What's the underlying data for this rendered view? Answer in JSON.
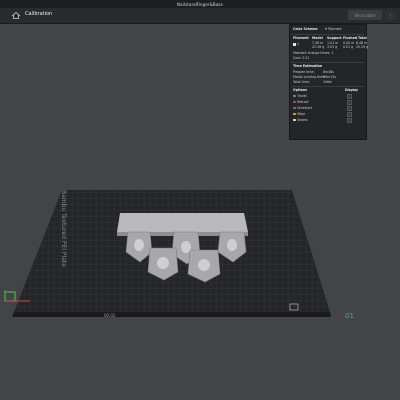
{
  "window": {
    "title": "NailstandFinger&Base"
  },
  "toolbar": {
    "tab_label": "Calibration",
    "slice_label": "Slice plate",
    "more_label": "⋮"
  },
  "panel": {
    "color_scheme_label": "Color Scheme",
    "color_scheme_value": "Filament",
    "headers": [
      "Filament",
      "Model",
      "Support",
      "Flushed",
      "Total"
    ],
    "filament_row": {
      "index": "1",
      "model": [
        "7.46 m",
        "22.26 g"
      ],
      "support": [
        "1.01 m",
        "3.03 g"
      ],
      "flushed": [
        "0.00 m",
        "0.01 g"
      ],
      "total": [
        "8.48 m",
        "25.29 g"
      ]
    },
    "change_times_label": "Filament change times:",
    "change_times_value": "1",
    "cost_label": "Cost:",
    "cost_value": "0.51",
    "time_title": "Time Estimation",
    "times": [
      {
        "label": "Prepare time:",
        "value": "6m48s"
      },
      {
        "label": "Model printing time:",
        "value": "59m13s"
      },
      {
        "label": "Total time:",
        "value": "1h6m"
      }
    ],
    "options_label": "Options",
    "display_label": "Display",
    "options": [
      {
        "name": "Travel",
        "color": "#8e7cc3"
      },
      {
        "name": "Retract",
        "color": "#a64d79"
      },
      {
        "name": "Unretract",
        "color": "#3d85c6"
      },
      {
        "name": "Wipe",
        "color": "#e6b800"
      },
      {
        "name": "Seams",
        "color": "#e8e8e8"
      }
    ]
  },
  "plate": {
    "vertical_label": "Bambu Textured PEI Plate",
    "corner_label": "01",
    "small_label": "00.02"
  }
}
